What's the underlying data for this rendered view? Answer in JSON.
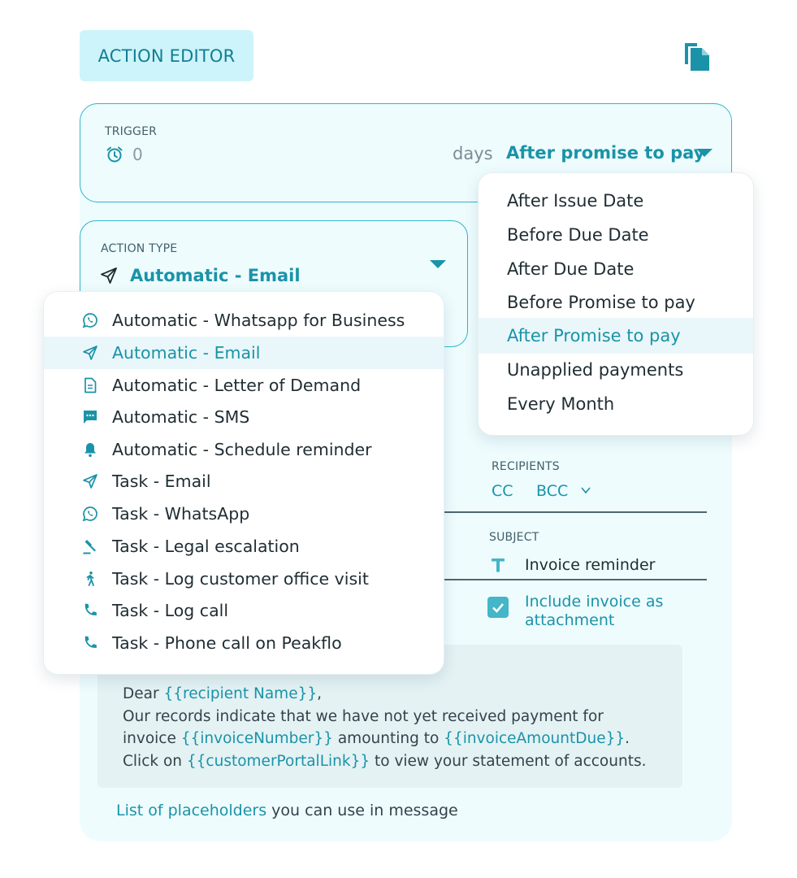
{
  "header": {
    "badge_label": "ACTION EDITOR",
    "copy_icon": "copy-icon"
  },
  "trigger": {
    "label": "TRIGGER",
    "icon": "alarm-clock-icon",
    "value": "0",
    "unit": "days",
    "selected": "After promise to pay",
    "options": [
      {
        "label": "After Issue Date",
        "selected": false
      },
      {
        "label": "Before Due Date",
        "selected": false
      },
      {
        "label": "After Due Date",
        "selected": false
      },
      {
        "label": "Before Promise to pay",
        "selected": false
      },
      {
        "label": "After Promise to pay",
        "selected": true
      },
      {
        "label": "Unapplied payments",
        "selected": false
      },
      {
        "label": "Every Month",
        "selected": false
      }
    ]
  },
  "action_type": {
    "label": "ACTION TYPE",
    "icon": "send-icon",
    "selected": "Automatic - Email",
    "options": [
      {
        "label": "Automatic - Whatsapp for Business",
        "icon": "whatsapp-icon",
        "selected": false
      },
      {
        "label": "Automatic - Email",
        "icon": "send-icon",
        "selected": true
      },
      {
        "label": "Automatic - Letter of Demand",
        "icon": "document-icon",
        "selected": false
      },
      {
        "label": "Automatic - SMS",
        "icon": "sms-icon",
        "selected": false
      },
      {
        "label": "Automatic - Schedule reminder",
        "icon": "bell-icon",
        "selected": false
      },
      {
        "label": "Task - Email",
        "icon": "send-icon",
        "selected": false
      },
      {
        "label": "Task - WhatsApp",
        "icon": "whatsapp-icon",
        "selected": false
      },
      {
        "label": "Task - Legal escalation",
        "icon": "gavel-icon",
        "selected": false
      },
      {
        "label": "Task - Log customer office visit",
        "icon": "walking-person-icon",
        "selected": false
      },
      {
        "label": "Task - Log call",
        "icon": "phone-icon",
        "selected": false
      },
      {
        "label": "Task - Phone call on Peakflo",
        "icon": "phone-icon",
        "selected": false
      }
    ]
  },
  "recipients": {
    "label": "RECIPIENTS",
    "cc": "CC",
    "bcc": "BCC"
  },
  "subject": {
    "label": "SUBJECT",
    "value": "Invoice reminder"
  },
  "attachment": {
    "label": "Include invoice as attachment",
    "checked": true
  },
  "message": {
    "line1_pre": "Dear ",
    "line1_ph": "{{recipient Name}}",
    "line1_post": ",",
    "line2": "Our records indicate that we have not yet received payment for",
    "line3_pre": "invoice ",
    "line3_ph1": "{{invoiceNumber}}",
    "line3_mid": " amounting to ",
    "line3_ph2": "{{invoiceAmountDue}}",
    "line3_post": ".",
    "line4_pre": "Click on ",
    "line4_ph": "{{customerPortalLink}}",
    "line4_post": " to view your statement of accounts."
  },
  "placeholders": {
    "link": "List of placeholders",
    "rest": " you can use in message"
  },
  "colors": {
    "accent": "#1a93a8",
    "panel_bg": "#eefcfe",
    "badge_bg": "#cdf4fa",
    "border": "#30b6cc"
  }
}
